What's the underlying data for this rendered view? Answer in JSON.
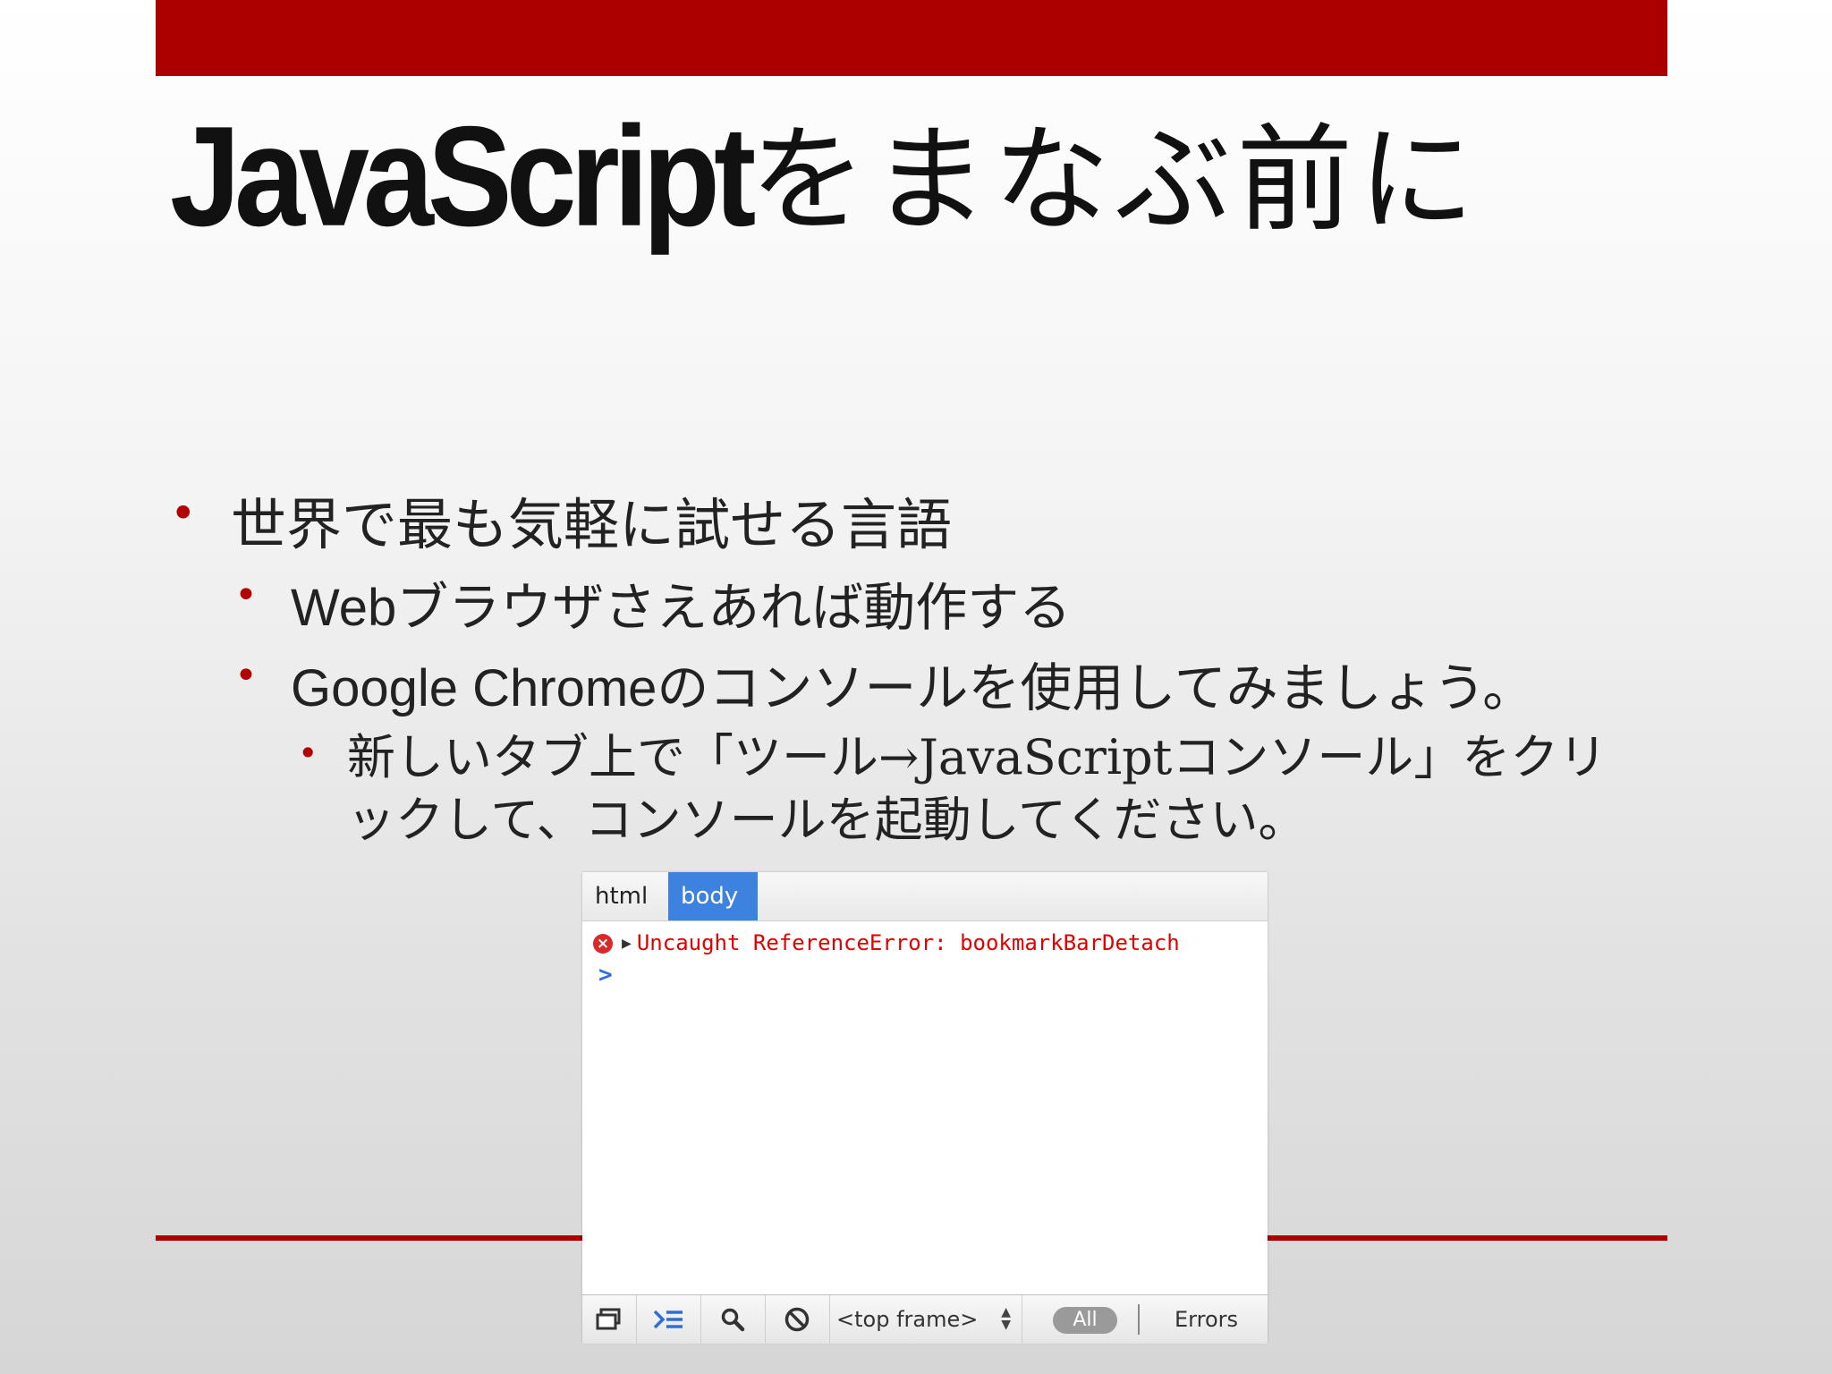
{
  "slide": {
    "title_latin": "JavaScript",
    "title_jp": "をまなぶ前に",
    "bullets": [
      "世界で最も気軽に試せる言語",
      "Webブラウザさえあれば動作する",
      "Google Chromeのコンソールを使用してみましょう。",
      "新しいタブ上で「ツール→JavaScriptコンソール」をクリックして、コンソールを起動してください。"
    ],
    "bullet_glyph": "•",
    "accent_color": "#aa0000"
  },
  "console": {
    "breadcrumbs": [
      "html",
      "body"
    ],
    "selected_breadcrumb": "body",
    "log_error": "Uncaught ReferenceError: bookmarkBarDetach",
    "error_icon": "error-x-icon",
    "expand_glyph": "▶",
    "prompt_glyph": ">",
    "toolbar": {
      "frame_select": "<top frame>",
      "filter_all": "All",
      "filter_errors": "Errors"
    }
  }
}
